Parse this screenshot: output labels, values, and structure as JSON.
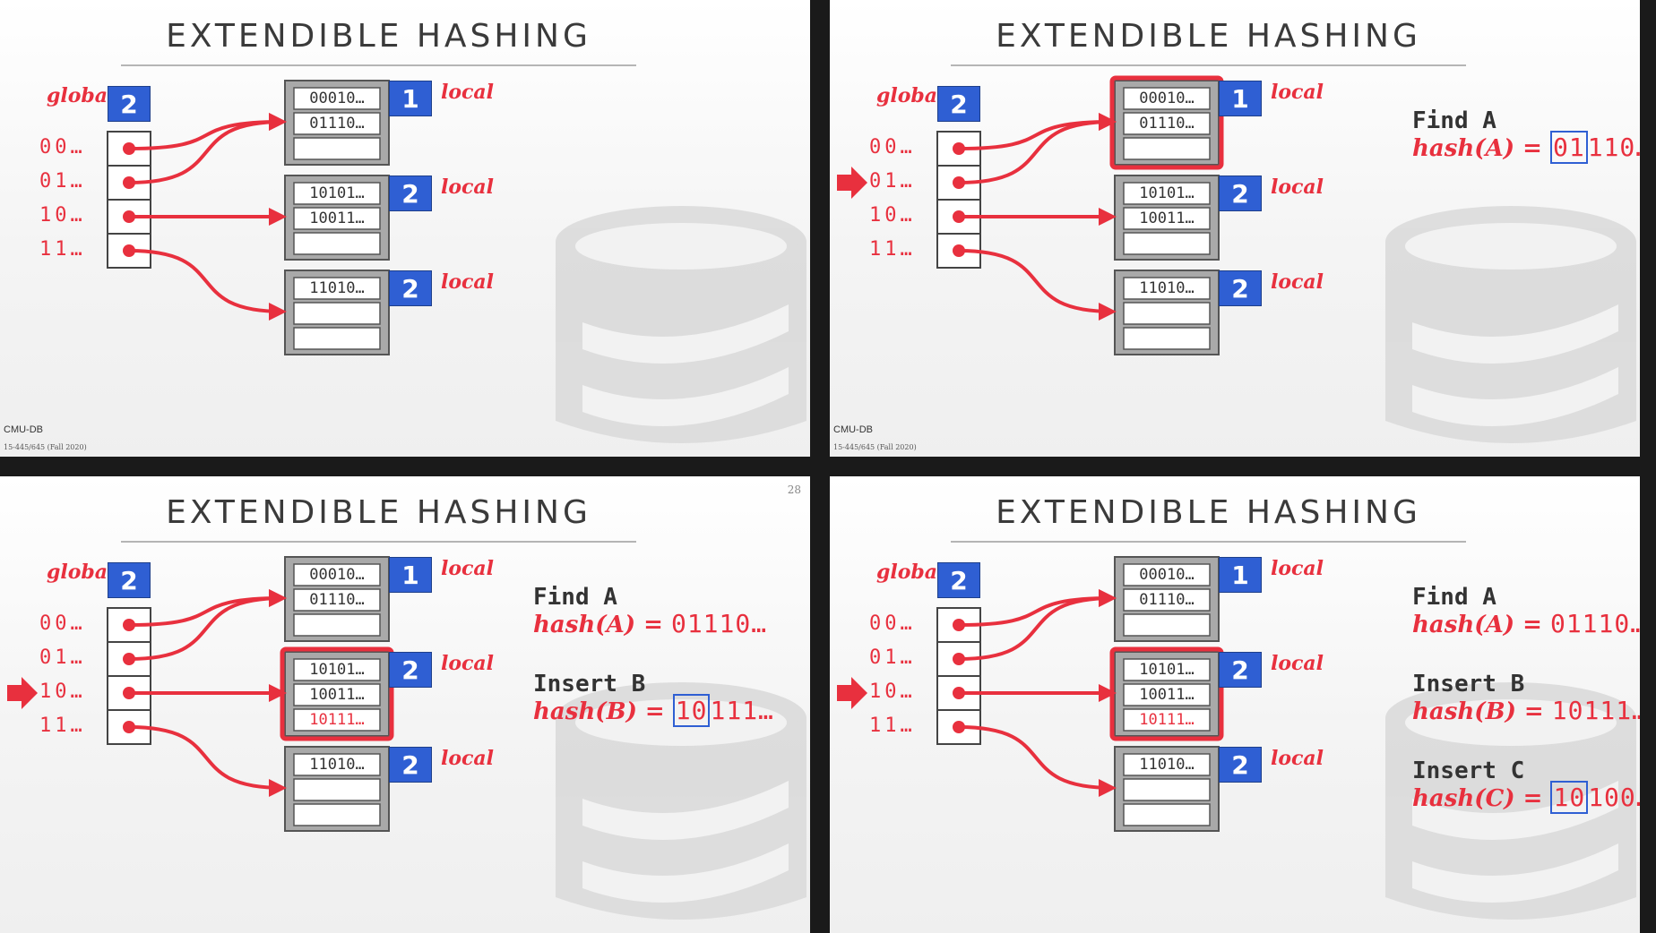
{
  "title": "EXTENDIBLE HASHING",
  "global_label": "global",
  "global_depth": "2",
  "local_label": "local",
  "directory_prefixes": [
    "00…",
    "01…",
    "10…",
    "11…"
  ],
  "buckets": [
    {
      "local_depth": "1",
      "slots": [
        "00010…",
        "01110…",
        ""
      ]
    },
    {
      "local_depth": "2",
      "slots": [
        "10101…",
        "10011…",
        ""
      ]
    },
    {
      "local_depth": "2",
      "slots": [
        "11010…",
        "",
        ""
      ]
    }
  ],
  "inserted_b": "10111…",
  "ops": {
    "find_a": {
      "head": "Find A",
      "hash": "hash(A) = ",
      "hl": "01",
      "rest": "110…",
      "full": "01110…"
    },
    "insert_b": {
      "head": "Insert B",
      "hash": "hash(B) = ",
      "hl": "10",
      "rest": "111…",
      "full": "10111…"
    },
    "insert_c": {
      "head": "Insert C",
      "hash": "hash(C) = ",
      "hl": "10",
      "rest": "100…"
    }
  },
  "footer": {
    "logo": "CMU-DB",
    "course": "15-445/645 (Fall 2020)",
    "page": "28"
  },
  "colors": {
    "accent_red": "#e8303e",
    "depth_blue": "#2f5fd3",
    "bucket_gray": "#a9a9a9"
  }
}
